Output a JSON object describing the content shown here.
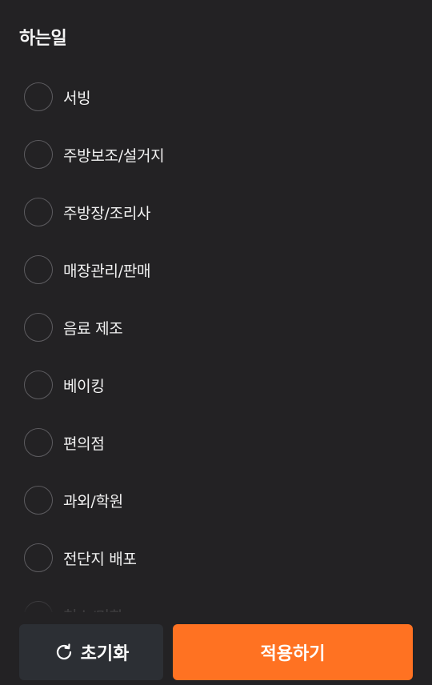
{
  "section": {
    "title": "하는일"
  },
  "options": [
    {
      "label": "서빙",
      "checked": false
    },
    {
      "label": "주방보조/설거지",
      "checked": false
    },
    {
      "label": "주방장/조리사",
      "checked": false
    },
    {
      "label": "매장관리/판매",
      "checked": false
    },
    {
      "label": "음료 제조",
      "checked": false
    },
    {
      "label": "베이킹",
      "checked": false
    },
    {
      "label": "편의점",
      "checked": false
    },
    {
      "label": "과외/학원",
      "checked": false
    },
    {
      "label": "전단지 배포",
      "checked": false
    },
    {
      "label": "청소/미화",
      "checked": false
    }
  ],
  "footer": {
    "reset_label": "초기화",
    "reset_icon": "refresh-icon",
    "apply_label": "적용하기"
  },
  "colors": {
    "background": "#232224",
    "accent": "#ff7222",
    "reset_button": "#2c2f34",
    "radio_border": "#5d5c60"
  }
}
